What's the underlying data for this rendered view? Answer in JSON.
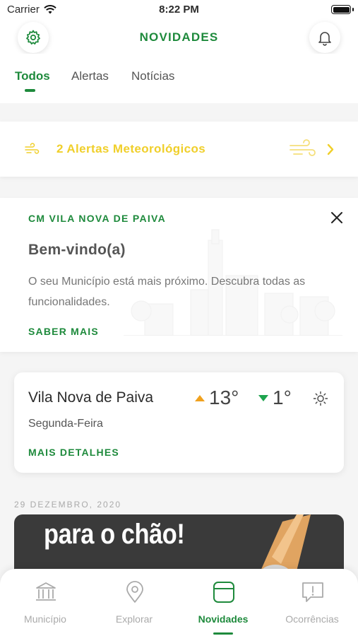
{
  "status_bar": {
    "carrier": "Carrier",
    "time": "8:22 PM"
  },
  "header": {
    "title": "NOVIDADES"
  },
  "tabs": [
    {
      "label": "Todos",
      "active": true
    },
    {
      "label": "Alertas",
      "active": false
    },
    {
      "label": "Notícias",
      "active": false
    }
  ],
  "alert_banner": {
    "text": "2 Alertas Meteorológicos",
    "color": "#f0cf2a"
  },
  "welcome": {
    "org": "CM VILA NOVA DE PAIVA",
    "title": "Bem-vindo(a)",
    "description": "O seu Município está mais próximo. Descubra todas as funcionalidades.",
    "link": "SABER MAIS"
  },
  "weather": {
    "city": "Vila Nova de Paiva",
    "day": "Segunda-Feira",
    "max": "13°",
    "min": "1°",
    "icon": "sun-icon",
    "link": "MAIS DETALHES"
  },
  "feed": {
    "date": "29 DEZEMBRO, 2020",
    "headline": "para o chão!"
  },
  "bottom_nav": [
    {
      "label": "Município",
      "icon": "town-hall-icon",
      "active": false
    },
    {
      "label": "Explorar",
      "icon": "location-pin-icon",
      "active": false
    },
    {
      "label": "Novidades",
      "icon": "news-icon",
      "active": true
    },
    {
      "label": "Ocorrências",
      "icon": "report-icon",
      "active": false
    }
  ],
  "colors": {
    "brand": "#1e8a3c",
    "alert": "#f0cf2a",
    "temp_up": "#f0a11e",
    "temp_down": "#1ea44e"
  }
}
